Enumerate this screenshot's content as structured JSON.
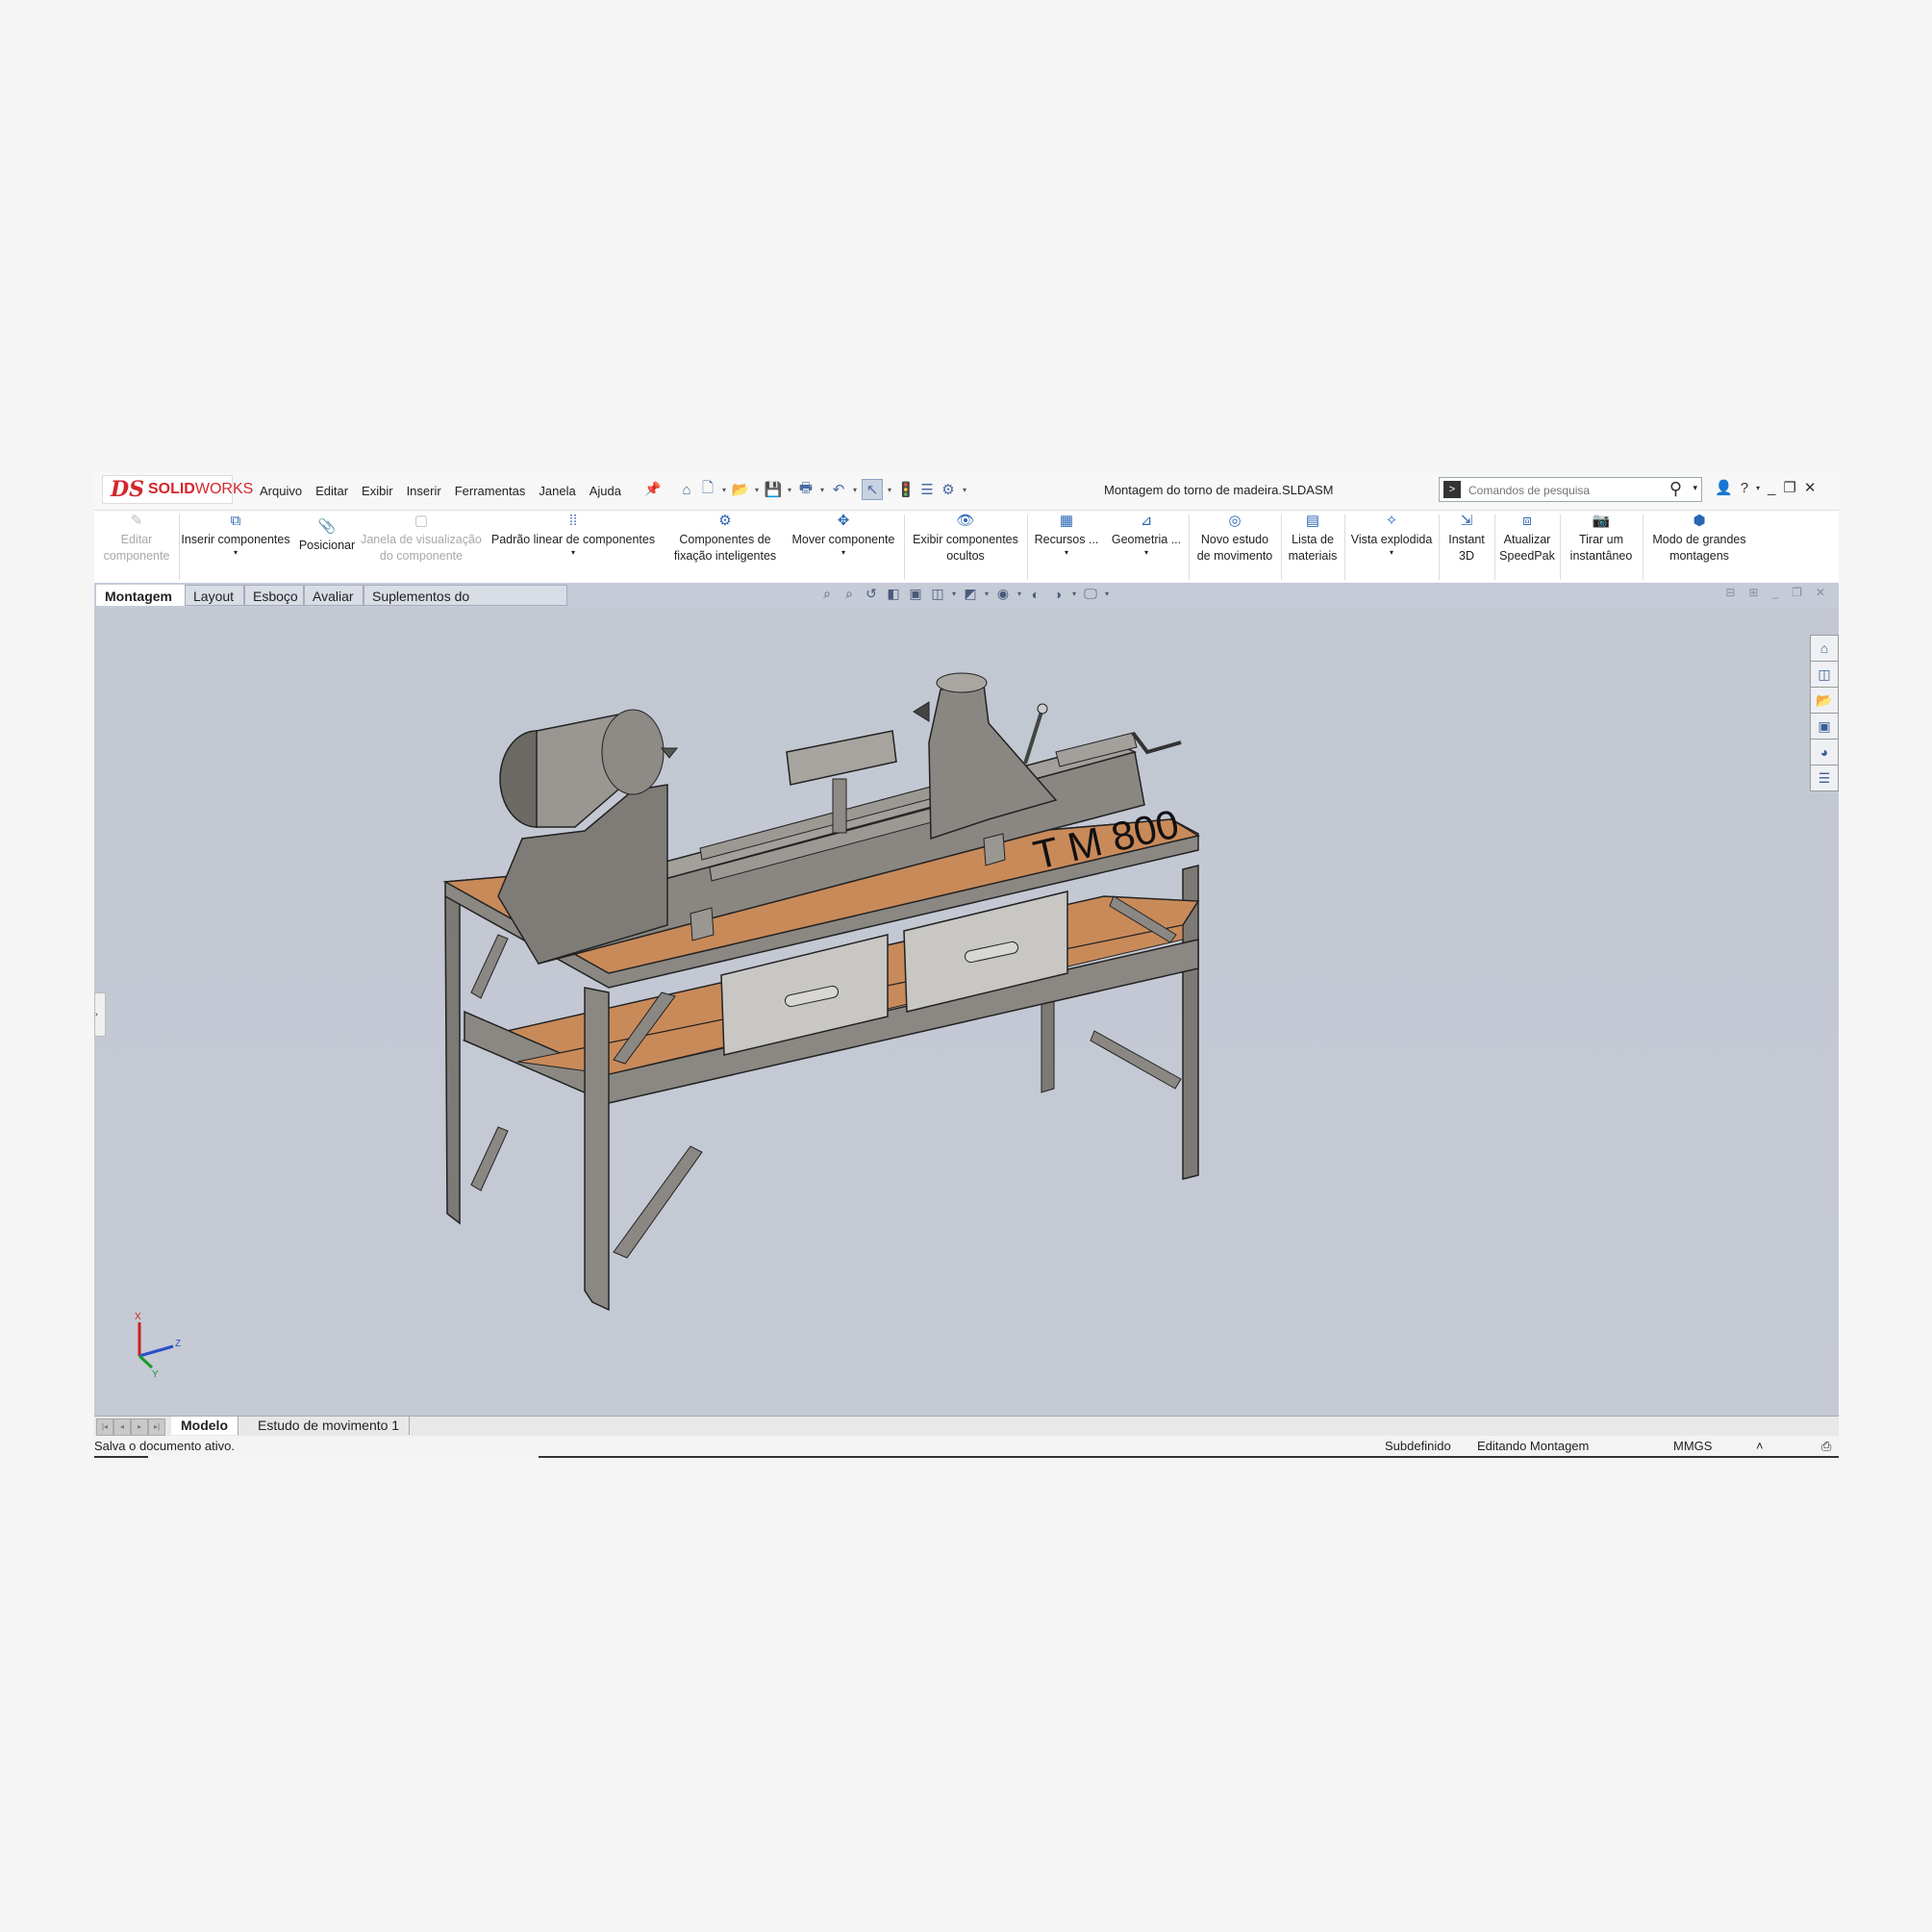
{
  "app": {
    "logo_ds": "DS",
    "logo_text_bold": "SOLID",
    "logo_text": "WORKS"
  },
  "menu": [
    "Arquivo",
    "Editar",
    "Exibir",
    "Inserir",
    "Ferramentas",
    "Janela",
    "Ajuda"
  ],
  "document_title": "Montagem do torno de madeira.SLDASM",
  "search": {
    "placeholder": "Comandos de pesquisa"
  },
  "ribbon": [
    {
      "label": "Editar",
      "label2": "componente",
      "icon": "edit-component-icon",
      "disabled": true
    },
    {
      "label": "Inserir componentes",
      "icon": "insert-components-icon",
      "dropdown": true
    },
    {
      "label": "Posicionar",
      "icon": "mate-icon"
    },
    {
      "label": "Janela de visualização",
      "label2": "do componente",
      "icon": "component-preview-icon",
      "disabled": true
    },
    {
      "label": "Padrão linear de componentes",
      "icon": "linear-pattern-icon",
      "dropdown": true
    },
    {
      "label": "Componentes de",
      "label2": "fixação inteligentes",
      "icon": "smart-fasteners-icon"
    },
    {
      "label": "Mover componente",
      "icon": "move-component-icon",
      "dropdown": true
    },
    {
      "label": "Exibir componentes",
      "label2": "ocultos",
      "icon": "show-hidden-icon"
    },
    {
      "label": "Recursos ...",
      "icon": "features-icon",
      "dropdown": true
    },
    {
      "label": "Geometria ...",
      "icon": "reference-geometry-icon",
      "dropdown": true
    },
    {
      "label": "Novo estudo",
      "label2": "de movimento",
      "icon": "motion-study-icon"
    },
    {
      "label": "Lista de",
      "label2": "materiais",
      "icon": "bill-of-materials-icon"
    },
    {
      "label": "Vista explodida",
      "icon": "exploded-view-icon",
      "dropdown": true
    },
    {
      "label": "Instant",
      "label2": "3D",
      "icon": "instant3d-icon"
    },
    {
      "label": "Atualizar",
      "label2": "SpeedPak",
      "icon": "speedpak-icon"
    },
    {
      "label": "Tirar um",
      "label2": "instantâneo",
      "icon": "snapshot-icon"
    },
    {
      "label": "Modo de grandes",
      "label2": "montagens",
      "icon": "large-assembly-icon"
    }
  ],
  "tabs": [
    "Montagem",
    "Layout",
    "Esboço",
    "Avaliar",
    "Suplementos do SOLIDWORKS"
  ],
  "model": {
    "engraving": "T M 800"
  },
  "triad": {
    "x": "X",
    "y": "Y",
    "z": "Z"
  },
  "bottom_tabs": [
    "Modelo",
    "Estudo de movimento 1"
  ],
  "status": {
    "message": "Salva o documento ativo.",
    "state": "Subdefinido",
    "mode": "Editando Montagem",
    "units": "MMGS",
    "arrow": "˄"
  },
  "colors": {
    "accent": "#d4262c",
    "viewport": "#c3c8d3",
    "wood": "#c98a5a",
    "steel": "#8a8782"
  }
}
